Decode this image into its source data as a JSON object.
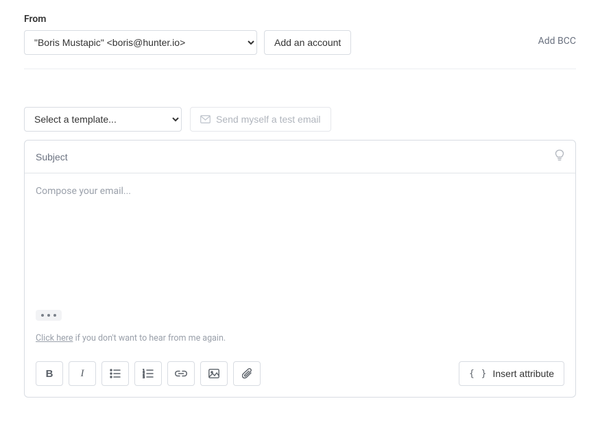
{
  "from": {
    "label": "From",
    "selected": "\"Boris Mustapic\" <boris@hunter.io>",
    "add_account_label": "Add an account",
    "add_bcc_label": "Add BCC"
  },
  "template": {
    "placeholder": "Select a template...",
    "test_email_label": "Send myself a test email"
  },
  "subject": {
    "placeholder": "Subject"
  },
  "compose": {
    "placeholder": "Compose your email..."
  },
  "unsubscribe": {
    "link_text": "Click here",
    "suffix_text": " if you don't want to hear from me again."
  },
  "toolbar": {
    "insert_attribute_label": "Insert attribute"
  }
}
